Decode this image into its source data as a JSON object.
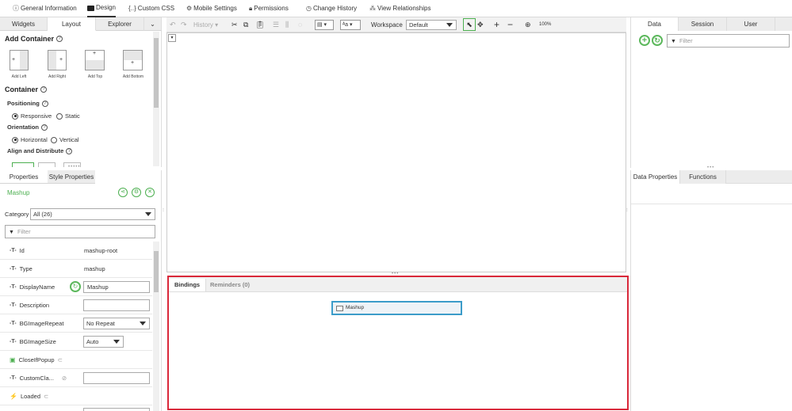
{
  "topnav": {
    "items": [
      {
        "icon": "info-icon",
        "label": "General Information"
      },
      {
        "icon": "design-icon",
        "label": "Design"
      },
      {
        "icon": "css-icon",
        "label": "Custom CSS"
      },
      {
        "icon": "gear-icon",
        "label": "Mobile Settings"
      },
      {
        "icon": "lock-icon",
        "label": "Permissions"
      },
      {
        "icon": "history-icon",
        "label": "Change History"
      },
      {
        "icon": "relationships-icon",
        "label": "View Relationships"
      }
    ],
    "css_glyph": "{..}"
  },
  "left_top": {
    "tabs": [
      "Widgets",
      "Layout",
      "Explorer"
    ],
    "active_tab": "Layout",
    "add_container": {
      "title": "Add Container",
      "items": [
        "Add Left",
        "Add Right",
        "Add Top",
        "Add Bottom"
      ]
    },
    "container": {
      "title": "Container",
      "positioning": {
        "label": "Positioning",
        "options": [
          "Responsive",
          "Static"
        ],
        "selected": "Responsive"
      },
      "orientation": {
        "label": "Orientation",
        "options": [
          "Horizontal",
          "Vertical"
        ],
        "selected": "Horizontal"
      },
      "align": {
        "label": "Align and Distribute"
      }
    }
  },
  "left_bottom": {
    "tabs": [
      "Properties",
      "Style Properties"
    ],
    "active_tab": "Properties",
    "entity_name": "Mashup",
    "category_label": "Category",
    "category_value": "All (26)",
    "filter_placeholder": "Filter",
    "properties": [
      {
        "name": "Id",
        "value": "mashup-root",
        "kind": "text"
      },
      {
        "name": "Type",
        "value": "mashup",
        "kind": "text"
      },
      {
        "name": "DisplayName",
        "value": "Mashup",
        "kind": "input"
      },
      {
        "name": "Description",
        "value": "",
        "kind": "input"
      },
      {
        "name": "BGImageRepeat",
        "value": "No Repeat",
        "kind": "select"
      },
      {
        "name": "BGImageSize",
        "value": "Auto",
        "kind": "select"
      },
      {
        "name": "CloseIfPopup",
        "value": "",
        "kind": "service"
      },
      {
        "name": "CustomCla...",
        "value": "",
        "kind": "input"
      },
      {
        "name": "Loaded",
        "value": "",
        "kind": "event"
      }
    ]
  },
  "toolbar": {
    "history_label": "History",
    "workspace_label": "Workspace",
    "workspace_value": "Default",
    "zoom": "100%"
  },
  "bindings": {
    "tabs": [
      "Bindings",
      "Reminders (0)"
    ],
    "active_tab": "Bindings",
    "node_label": "Mashup"
  },
  "right_top": {
    "tabs": [
      "Data",
      "Session",
      "User"
    ],
    "active_tab": "Data",
    "filter_placeholder": "Filter"
  },
  "right_bottom": {
    "tabs": [
      "Data Properties",
      "Functions"
    ],
    "active_tab": "Data Properties"
  },
  "colors": {
    "accent_green": "#4caf50",
    "bindings_border": "#d9283a",
    "node_border": "#3c9cc9"
  }
}
